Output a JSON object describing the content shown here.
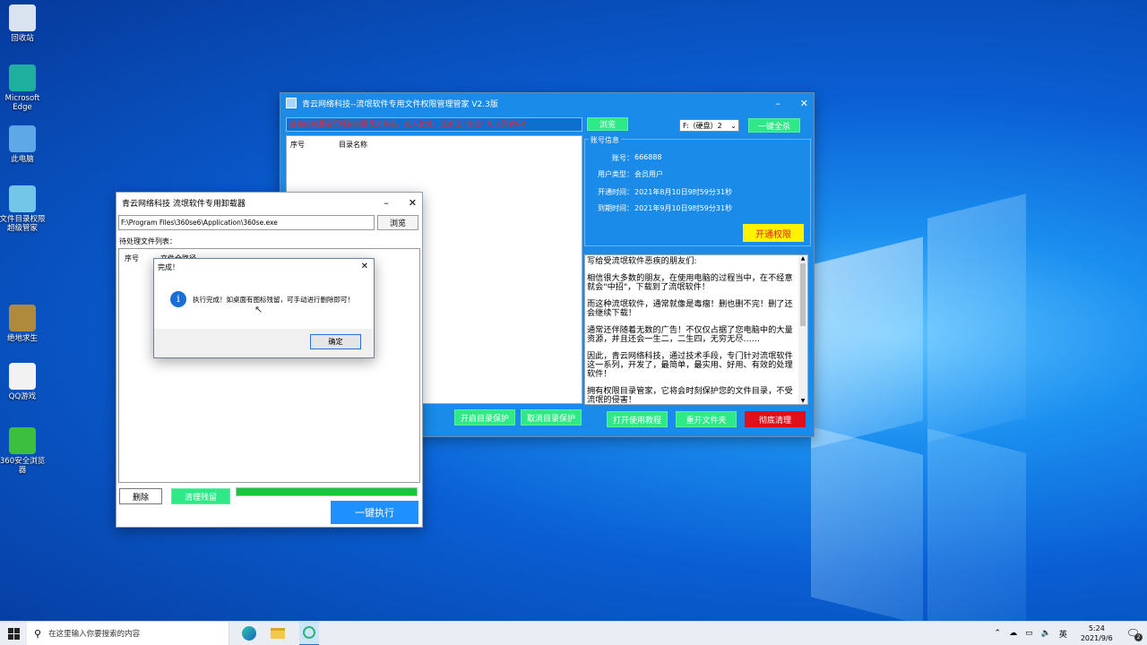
{
  "desktop": {
    "icons": [
      {
        "label": "回收站",
        "icon": "recycle-bin-icon",
        "color": "#d9e3ef"
      },
      {
        "label": "Microsoft Edge",
        "icon": "edge-icon",
        "color": "#1faf9f"
      },
      {
        "label": "此电脑",
        "icon": "computer-icon",
        "color": "#5fa8e8"
      },
      {
        "label": "文件目录权限超级管家",
        "icon": "app-icon",
        "color": "#74c6e8"
      },
      {
        "label": "绝地求生",
        "icon": "game-icon",
        "color": "#b08a3c"
      },
      {
        "label": "QQ游戏",
        "icon": "qq-icon",
        "color": "#f2f2f2"
      },
      {
        "label": "360安全浏览器",
        "icon": "browser-360-icon",
        "color": "#3cbf3c"
      }
    ]
  },
  "main_window": {
    "title": "青云网络科技--流氓软件专用文件权限管理管家 V2.3版",
    "minimize": "–",
    "close": "✕",
    "path_hint": "请直接将要进行保护的目录文件夹，拖入此处！或点击 \"浏览\" 加入列表中！",
    "browse_label": "浏览",
    "drive_select": "F:（硬盘）2",
    "one_key_label": "一键全杀",
    "list_headers": [
      "序号",
      "目录名称"
    ],
    "account_group_title": "账号信息",
    "account": {
      "account_label": "账号：",
      "account_value": "666888",
      "type_label": "用户类型：",
      "type_value": "会员用户",
      "open_label": "开通时间：",
      "open_value": "2021年8月10日9时59分31秒",
      "expire_label": "到期时间：",
      "expire_value": "2021年9月10日9时59分31秒"
    },
    "activate_label": "开通权限",
    "letter": [
      "写给受流氓软件恶疾的朋友们:",
      "相信很大多数的朋友，在使用电脑的过程当中，在不经意就会\"中招\"，下载到了流氓软件！",
      "而这种流氓软件，通常就像是毒瘤！删也删不完！删了还会继续下载！",
      "通常还伴随着无数的广告！不仅仅占据了您电脑中的大量资源，并且还会一生二，二生四，无穷无尽……",
      "因此，青云网络科技，通过技术手段，专门针对流氓软件这一系列，开发了，最简单，最实用、好用、有效的处理软件！",
      "拥有权限目录管家，它将会时刻保护您的文件目录，不受流氓的侵害！"
    ],
    "buttons": {
      "enable_protect": "开启目录保护",
      "cancel_protect": "取消目录保护",
      "open_tutorial": "打开使用教程",
      "open_folder": "重开文件夹",
      "clean": "彻底清理"
    }
  },
  "uninstaller": {
    "title": "青云网络科技 流氓软件专用卸载器",
    "minimize": "–",
    "close": "✕",
    "path_value": "F:\\Program Files\\360se6\\Application\\360se.exe",
    "browse_label": "浏览",
    "pending_label": "待处理文件列表：",
    "list_headers": [
      "序号",
      "文件全路径"
    ],
    "delete_label": "删除",
    "clean_process_label": "清理残留",
    "progress": 1.0,
    "execute_label": "一键执行"
  },
  "dialog": {
    "title": "完成！",
    "close": "✕",
    "message": "执行完成！如桌面有图标残留，可手动进行删除即可！",
    "ok_label": "确定"
  },
  "taskbar": {
    "search_placeholder": "在这里输入你要搜索的内容",
    "ime": "英",
    "time": "5:24",
    "date": "2021/9/6",
    "notification_count": "2"
  }
}
